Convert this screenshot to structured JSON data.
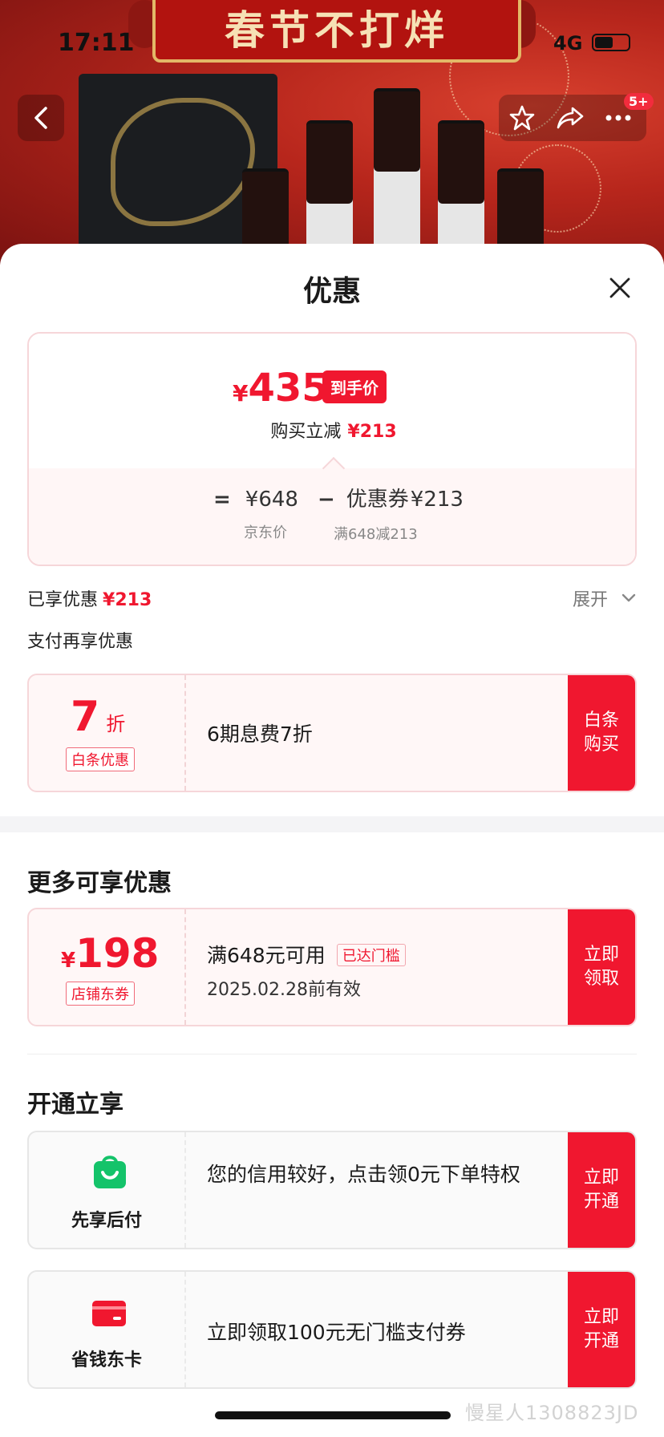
{
  "status_bar": {
    "time": "17:11",
    "network": "4G"
  },
  "hero": {
    "banner_text": "春节不打烊",
    "badge": "5+"
  },
  "sheet": {
    "title": "优惠",
    "summary": {
      "currency": "¥",
      "final_price": "435",
      "final_tag": "到手价",
      "reduce_label": "购买立减",
      "reduce_amount": "¥213",
      "equals": "=",
      "jd_price": "¥648",
      "minus": "−",
      "coupon_label": "优惠券",
      "coupon_amount": "¥213",
      "jd_price_label": "京东价",
      "coupon_rule": "满648减213"
    },
    "enjoyed_label": "已享优惠",
    "enjoyed_amount": "¥213",
    "expand_label": "展开",
    "pay_more_label": "支付再享优惠",
    "baitiao_card": {
      "discount": "7",
      "discount_unit": "折",
      "tag": "白条优惠",
      "text": "6期息费7折",
      "action": "白条购买"
    },
    "more_section_title": "更多可享优惠",
    "coupon_card": {
      "currency": "¥",
      "amount": "198",
      "tag": "店铺东券",
      "condition": "满648元可用",
      "reached_tag": "已达门槛",
      "expiry": "2025.02.28前有效",
      "action": "立即领取"
    },
    "open_section_title": "开通立享",
    "xianxiang_card": {
      "name": "先享后付",
      "text": "您的信用较好，点击领0元下单特权",
      "action": "立即开通"
    },
    "shengqian_card": {
      "name": "省钱东卡",
      "text": "立即领取100元无门槛支付券",
      "action": "立即开通"
    }
  },
  "watermark": "慢星人1308823JD",
  "colors": {
    "accent_red": "#f0172f",
    "green_icon": "#14c36a",
    "card_pink": "#fff7f7"
  }
}
